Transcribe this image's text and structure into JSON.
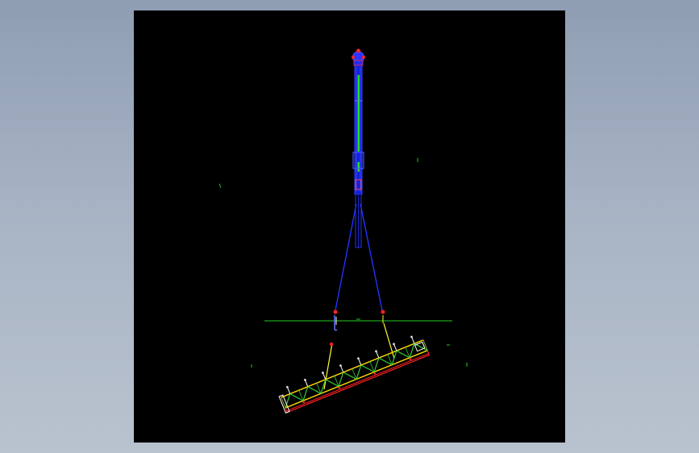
{
  "viewport": {
    "background": "#000000",
    "outer_background": "#a3afc0"
  },
  "colors": {
    "mast": "#1e2cff",
    "mast_core": "#22dd22",
    "cable": "#2233ff",
    "sling": "#ffff33",
    "truss_web": "#33cc33",
    "truss_chord": "#ffdd00",
    "truss_outline": "#ff2222",
    "ground_line": "#22cc22",
    "marker": "#ff2222",
    "ticks": "#22cc22"
  },
  "icons": {
    "crane_top": "crane-head-icon",
    "hook": "hook-icon"
  },
  "truss": {
    "panels": 8,
    "tilt_deg": -22
  }
}
